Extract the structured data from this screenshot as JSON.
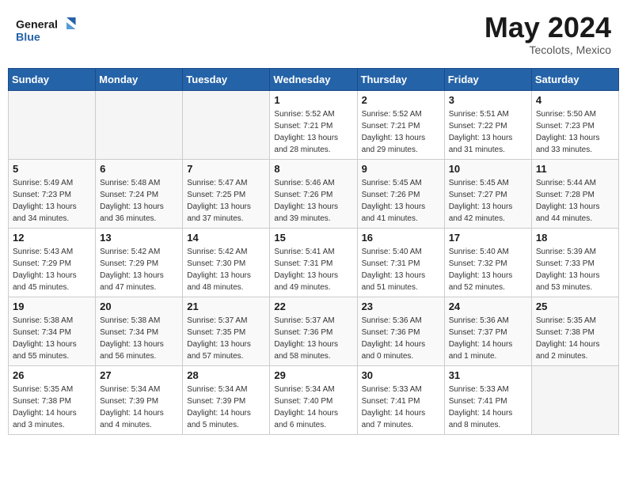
{
  "header": {
    "logo_line1": "General",
    "logo_line2": "Blue",
    "month_title": "May 2024",
    "location": "Tecolots, Mexico"
  },
  "days_of_week": [
    "Sunday",
    "Monday",
    "Tuesday",
    "Wednesday",
    "Thursday",
    "Friday",
    "Saturday"
  ],
  "weeks": [
    {
      "alt": false,
      "days": [
        {
          "num": "",
          "info": ""
        },
        {
          "num": "",
          "info": ""
        },
        {
          "num": "",
          "info": ""
        },
        {
          "num": "1",
          "info": "Sunrise: 5:52 AM\nSunset: 7:21 PM\nDaylight: 13 hours\nand 28 minutes."
        },
        {
          "num": "2",
          "info": "Sunrise: 5:52 AM\nSunset: 7:21 PM\nDaylight: 13 hours\nand 29 minutes."
        },
        {
          "num": "3",
          "info": "Sunrise: 5:51 AM\nSunset: 7:22 PM\nDaylight: 13 hours\nand 31 minutes."
        },
        {
          "num": "4",
          "info": "Sunrise: 5:50 AM\nSunset: 7:23 PM\nDaylight: 13 hours\nand 33 minutes."
        }
      ]
    },
    {
      "alt": true,
      "days": [
        {
          "num": "5",
          "info": "Sunrise: 5:49 AM\nSunset: 7:23 PM\nDaylight: 13 hours\nand 34 minutes."
        },
        {
          "num": "6",
          "info": "Sunrise: 5:48 AM\nSunset: 7:24 PM\nDaylight: 13 hours\nand 36 minutes."
        },
        {
          "num": "7",
          "info": "Sunrise: 5:47 AM\nSunset: 7:25 PM\nDaylight: 13 hours\nand 37 minutes."
        },
        {
          "num": "8",
          "info": "Sunrise: 5:46 AM\nSunset: 7:26 PM\nDaylight: 13 hours\nand 39 minutes."
        },
        {
          "num": "9",
          "info": "Sunrise: 5:45 AM\nSunset: 7:26 PM\nDaylight: 13 hours\nand 41 minutes."
        },
        {
          "num": "10",
          "info": "Sunrise: 5:45 AM\nSunset: 7:27 PM\nDaylight: 13 hours\nand 42 minutes."
        },
        {
          "num": "11",
          "info": "Sunrise: 5:44 AM\nSunset: 7:28 PM\nDaylight: 13 hours\nand 44 minutes."
        }
      ]
    },
    {
      "alt": false,
      "days": [
        {
          "num": "12",
          "info": "Sunrise: 5:43 AM\nSunset: 7:29 PM\nDaylight: 13 hours\nand 45 minutes."
        },
        {
          "num": "13",
          "info": "Sunrise: 5:42 AM\nSunset: 7:29 PM\nDaylight: 13 hours\nand 47 minutes."
        },
        {
          "num": "14",
          "info": "Sunrise: 5:42 AM\nSunset: 7:30 PM\nDaylight: 13 hours\nand 48 minutes."
        },
        {
          "num": "15",
          "info": "Sunrise: 5:41 AM\nSunset: 7:31 PM\nDaylight: 13 hours\nand 49 minutes."
        },
        {
          "num": "16",
          "info": "Sunrise: 5:40 AM\nSunset: 7:31 PM\nDaylight: 13 hours\nand 51 minutes."
        },
        {
          "num": "17",
          "info": "Sunrise: 5:40 AM\nSunset: 7:32 PM\nDaylight: 13 hours\nand 52 minutes."
        },
        {
          "num": "18",
          "info": "Sunrise: 5:39 AM\nSunset: 7:33 PM\nDaylight: 13 hours\nand 53 minutes."
        }
      ]
    },
    {
      "alt": true,
      "days": [
        {
          "num": "19",
          "info": "Sunrise: 5:38 AM\nSunset: 7:34 PM\nDaylight: 13 hours\nand 55 minutes."
        },
        {
          "num": "20",
          "info": "Sunrise: 5:38 AM\nSunset: 7:34 PM\nDaylight: 13 hours\nand 56 minutes."
        },
        {
          "num": "21",
          "info": "Sunrise: 5:37 AM\nSunset: 7:35 PM\nDaylight: 13 hours\nand 57 minutes."
        },
        {
          "num": "22",
          "info": "Sunrise: 5:37 AM\nSunset: 7:36 PM\nDaylight: 13 hours\nand 58 minutes."
        },
        {
          "num": "23",
          "info": "Sunrise: 5:36 AM\nSunset: 7:36 PM\nDaylight: 14 hours\nand 0 minutes."
        },
        {
          "num": "24",
          "info": "Sunrise: 5:36 AM\nSunset: 7:37 PM\nDaylight: 14 hours\nand 1 minute."
        },
        {
          "num": "25",
          "info": "Sunrise: 5:35 AM\nSunset: 7:38 PM\nDaylight: 14 hours\nand 2 minutes."
        }
      ]
    },
    {
      "alt": false,
      "days": [
        {
          "num": "26",
          "info": "Sunrise: 5:35 AM\nSunset: 7:38 PM\nDaylight: 14 hours\nand 3 minutes."
        },
        {
          "num": "27",
          "info": "Sunrise: 5:34 AM\nSunset: 7:39 PM\nDaylight: 14 hours\nand 4 minutes."
        },
        {
          "num": "28",
          "info": "Sunrise: 5:34 AM\nSunset: 7:39 PM\nDaylight: 14 hours\nand 5 minutes."
        },
        {
          "num": "29",
          "info": "Sunrise: 5:34 AM\nSunset: 7:40 PM\nDaylight: 14 hours\nand 6 minutes."
        },
        {
          "num": "30",
          "info": "Sunrise: 5:33 AM\nSunset: 7:41 PM\nDaylight: 14 hours\nand 7 minutes."
        },
        {
          "num": "31",
          "info": "Sunrise: 5:33 AM\nSunset: 7:41 PM\nDaylight: 14 hours\nand 8 minutes."
        },
        {
          "num": "",
          "info": ""
        }
      ]
    }
  ]
}
